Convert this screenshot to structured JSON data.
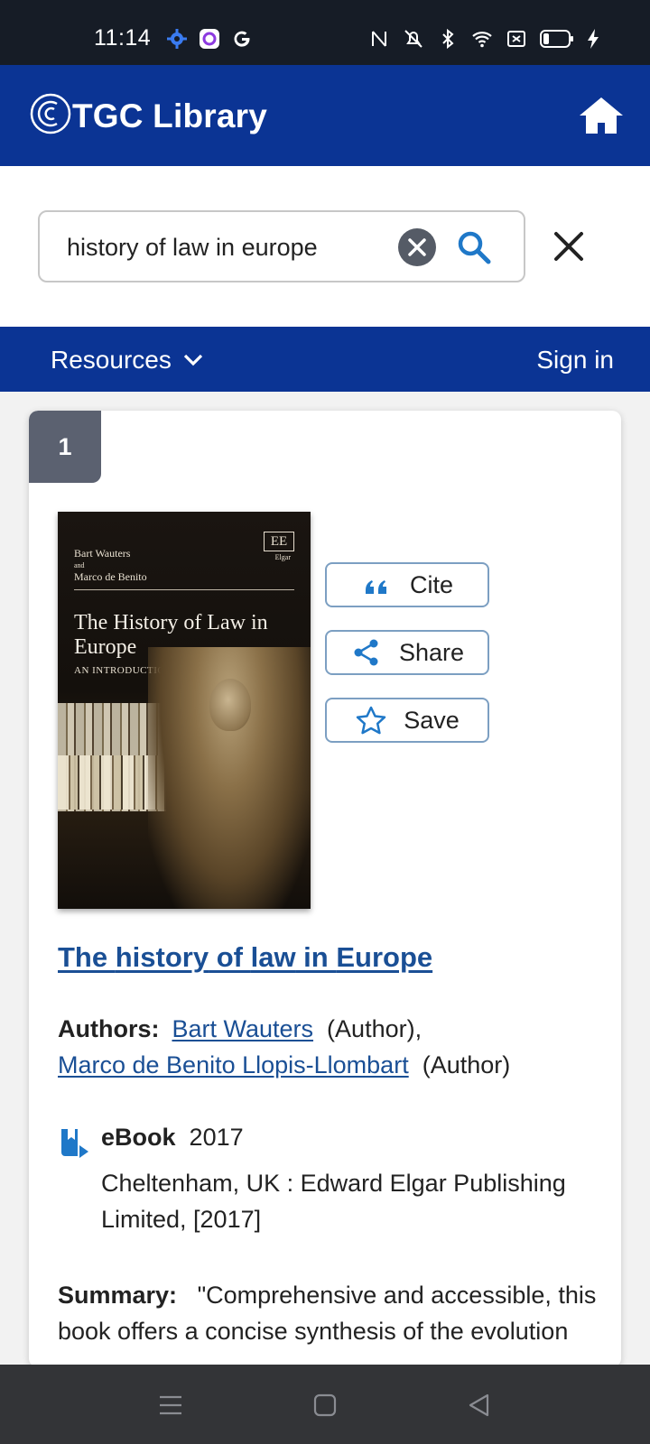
{
  "status_bar": {
    "time": "11:14",
    "left_icons": [
      "settings-icon",
      "camera-app-icon",
      "google-icon"
    ],
    "right_icons": [
      "nfc-icon",
      "vibrate-icon",
      "bluetooth-icon",
      "wifi-icon",
      "sim-icon",
      "battery-icon",
      "charging-icon"
    ]
  },
  "header": {
    "app_title": "TGC Library",
    "home_icon": "home-icon",
    "color": "#0b3494"
  },
  "search": {
    "value": "history of law in europe",
    "placeholder": "",
    "clear_icon": "clear-icon",
    "search_icon": "search-icon",
    "close_icon": "close-icon"
  },
  "nav": {
    "resources_label": "Resources",
    "signin_label": "Sign in"
  },
  "result": {
    "number": "1",
    "cover": {
      "author1": "Bart Wauters",
      "and": "and",
      "author2": "Marco de Benito",
      "publisher_mark": "EE",
      "publisher_name": "Elgar",
      "title": "The History of Law in Europe",
      "subtitle": "AN INTRODUCTION"
    },
    "actions": {
      "cite": "Cite",
      "share": "Share",
      "save": "Save"
    },
    "title_parts": [
      "The ",
      "history",
      " of ",
      "law",
      " in ",
      "Europe"
    ],
    "authors_label": "Authors:",
    "author1": "Bart Wauters",
    "author1_role": "(Author),",
    "author2": "Marco de Benito Llopis-Llombart",
    "author2_role": "(Author)",
    "format": "eBook",
    "year": "2017",
    "publisher": "Cheltenham, UK : Edward Elgar Publishing Limited, [2017]",
    "summary_label": "Summary:",
    "summary": "\"Comprehensive and accessible, this book offers a concise synthesis of the evolution"
  },
  "accent_colors": {
    "link": "#1a4f95",
    "highlight": "#f2c500",
    "number_badge": "#5b6170"
  }
}
